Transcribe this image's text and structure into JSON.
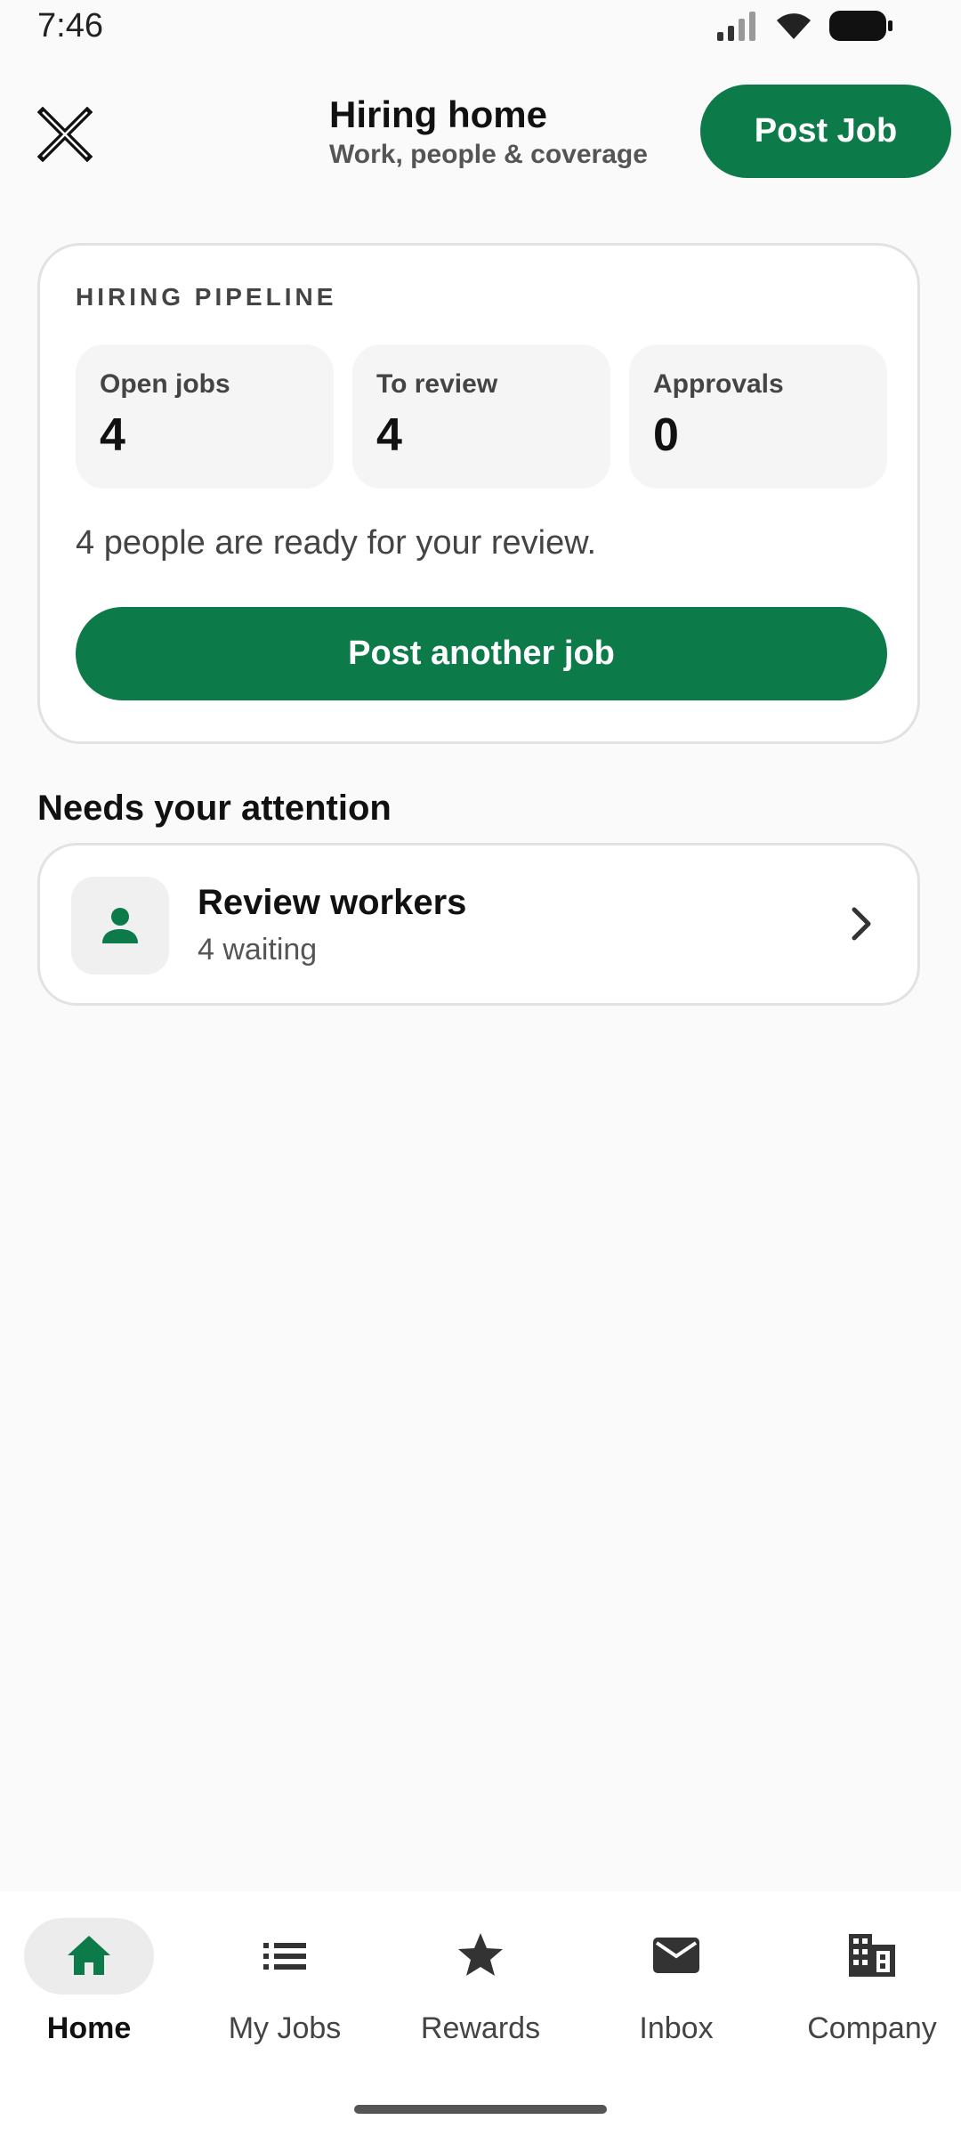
{
  "status_bar": {
    "time": "7:46"
  },
  "header": {
    "title": "Hiring home",
    "subtitle": "Work, people & coverage",
    "post_job_label": "Post Job"
  },
  "pipeline": {
    "section_label": "HIRING PIPELINE",
    "stats": [
      {
        "label": "Open jobs",
        "value": "4"
      },
      {
        "label": "To review",
        "value": "4"
      },
      {
        "label": "Approvals",
        "value": "0"
      }
    ],
    "ready_text": "4 people are ready for your review.",
    "post_another_label": "Post another job"
  },
  "attention": {
    "heading": "Needs your attention",
    "items": [
      {
        "title": "Review workers",
        "subtitle": "4 waiting",
        "icon": "person-icon"
      }
    ]
  },
  "bottom_nav": {
    "items": [
      {
        "label": "Home",
        "icon": "home-icon",
        "active": true
      },
      {
        "label": "My Jobs",
        "icon": "list-icon",
        "active": false
      },
      {
        "label": "Rewards",
        "icon": "star-icon",
        "active": false
      },
      {
        "label": "Inbox",
        "icon": "mail-icon",
        "active": false
      },
      {
        "label": "Company",
        "icon": "building-icon",
        "active": false
      }
    ]
  },
  "colors": {
    "brand_green": "#0d7a49",
    "background": "#fafafa"
  }
}
